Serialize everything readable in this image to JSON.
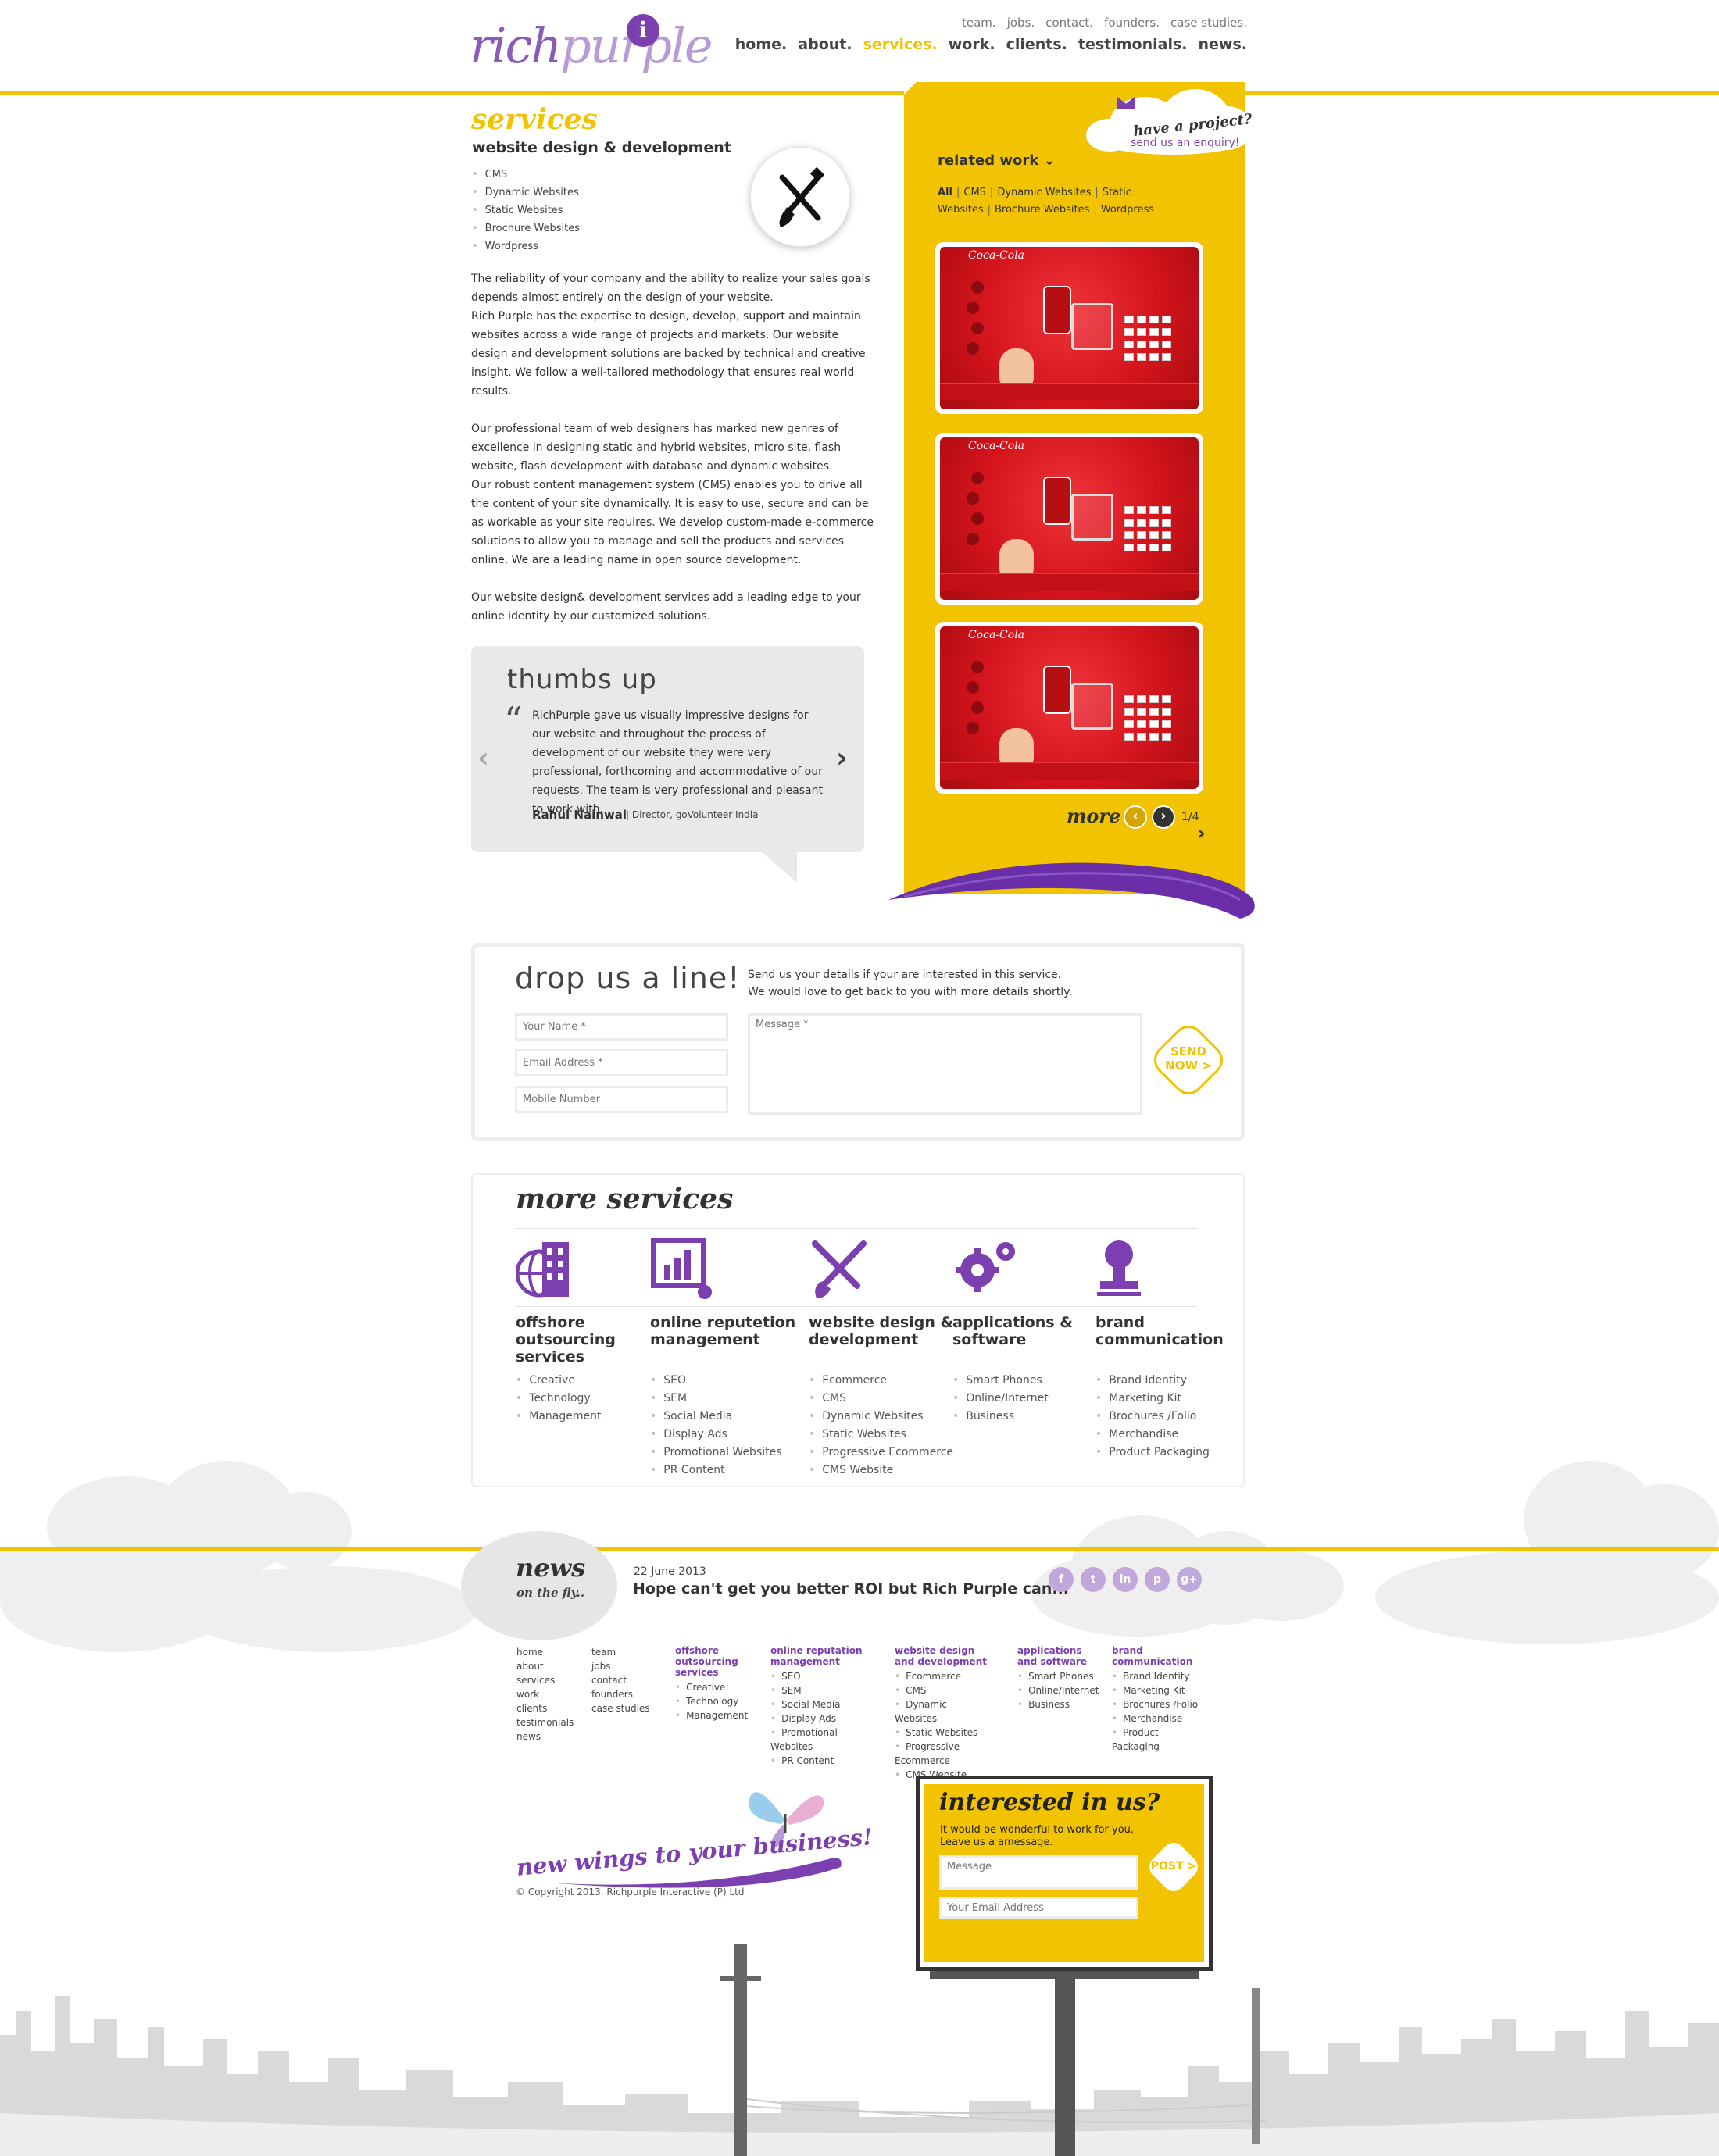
{
  "brand": {
    "part1": "rich",
    "part2": "purple",
    "badge": "i"
  },
  "top_links": [
    "team.",
    "jobs.",
    "contact.",
    "founders.",
    "case studies."
  ],
  "main_nav": [
    {
      "label": "home.",
      "active": false
    },
    {
      "label": "about.",
      "active": false
    },
    {
      "label": "services.",
      "active": true
    },
    {
      "label": "work.",
      "active": false
    },
    {
      "label": "clients.",
      "active": false
    },
    {
      "label": "testimonials.",
      "active": false
    },
    {
      "label": "news.",
      "active": false
    }
  ],
  "services": {
    "title": "services",
    "subtitle": "website design & development",
    "list": [
      "CMS",
      "Dynamic Websites",
      "Static Websites",
      "Brochure Websites",
      "Wordpress"
    ],
    "icon": "pencil-brush-icon",
    "paragraphs": [
      "The reliability of your company and the ability to realize your sales goals depends almost entirely on the design of your website.\nRich Purple has the expertise to design, develop, support and maintain websites across a wide range of projects and markets. Our website design and development solutions are backed by technical and creative insight. We follow a well-tailored methodology that ensures real world results.",
      "Our professional team of web designers has marked new genres of excellence in designing static and hybrid websites, micro site, flash website, flash development with database and dynamic websites.\nOur robust content management system (CMS) enables you to drive all the content of your site dynamically. It is easy to use, secure and can be as workable as your site requires. We develop custom-made e-commerce solutions to allow you to manage and sell the products and services online. We are a leading name in open source development.",
      "Our website design& development services add a leading edge to your online identity by our customized solutions."
    ]
  },
  "testimonial": {
    "title": "thumbs up",
    "quote_mark": "“",
    "text": "RichPurple gave us visually impressive designs for our website and throughout the process of development of our website they were very professional, forthcoming and accommodative of our requests. The team is very professional and pleasant to work with.",
    "author": "Rahul Nainwal",
    "role": "| Director, goVolunteer India",
    "prev": "‹",
    "next": "›"
  },
  "sidebar": {
    "project_question": "have a project?",
    "project_link": "send us an enquiry!",
    "related_heading": "related work ⌄",
    "filters": [
      "All",
      "CMS",
      "Dynamic Websites",
      "Static Websites",
      "Brochure Websites",
      "Wordpress"
    ],
    "thumb_logo": "Coca-Cola",
    "more_label": "more",
    "more_prev": "‹",
    "more_next": "›",
    "page_indicator": "1/4",
    "more_arrow": "›"
  },
  "contact": {
    "title": "drop us a line!",
    "desc_line1": "Send us your details if your are interested in this service.",
    "desc_line2": "We would love to get back to you with more details shortly.",
    "name_placeholder": "Your Name *",
    "email_placeholder": "Email Address *",
    "mobile_placeholder": "Mobile Number",
    "message_placeholder": "Message *",
    "send_line1": "SEND",
    "send_line2": "NOW >"
  },
  "more_services": {
    "title": "more services",
    "columns": [
      {
        "icon": "building-globe-icon",
        "title": "offshore outsourcing services",
        "items": [
          "Creative",
          "Technology",
          "Management"
        ]
      },
      {
        "icon": "chart-screen-icon",
        "title": "online reputetion management",
        "items": [
          "SEO",
          "SEM",
          "Social Media",
          "Display Ads",
          "Promotional Websites",
          "PR Content"
        ]
      },
      {
        "icon": "pencil-brush-icon",
        "title": "website design & development",
        "items": [
          "Ecommerce",
          "CMS",
          "Dynamic Websites",
          "Static Websites",
          "Progressive Ecommerce",
          "CMS Website"
        ]
      },
      {
        "icon": "gears-icon",
        "title": "applications & software",
        "items": [
          "Smart Phones",
          "Online/Internet",
          "Business"
        ]
      },
      {
        "icon": "stamp-icon",
        "title": "brand communication",
        "items": [
          "Brand Identity",
          "Marketing Kit",
          "Brochures /Folio",
          "Merchandise",
          "Product Packaging"
        ]
      }
    ]
  },
  "news": {
    "title": "news",
    "subtitle": "on the fly..",
    "date": "22 June 2013",
    "headline": "Hope can't get you better ROI but Rich Purple can..."
  },
  "social": [
    {
      "icon": "facebook-icon",
      "glyph": "f"
    },
    {
      "icon": "twitter-icon",
      "glyph": "t"
    },
    {
      "icon": "linkedin-icon",
      "glyph": "in"
    },
    {
      "icon": "pinterest-icon",
      "glyph": "p"
    },
    {
      "icon": "googleplus-icon",
      "glyph": "g+"
    }
  ],
  "footer": {
    "col1": [
      "home",
      "about",
      "services",
      "work",
      "clients",
      "testimonials",
      "news"
    ],
    "col2": [
      "team",
      "jobs",
      "contact",
      "founders",
      "case studies"
    ],
    "groups": [
      {
        "title": "offshore outsourcing services",
        "items": [
          "Creative",
          "Technology",
          "Management"
        ]
      },
      {
        "title": "online reputation management",
        "items": [
          "SEO",
          "SEM",
          "Social Media",
          "Display Ads",
          "Promotional Websites",
          "PR Content"
        ]
      },
      {
        "title": "website design and development",
        "items": [
          "Ecommerce",
          "CMS",
          "Dynamic Websites",
          "Static Websites",
          "Progressive Ecommerce",
          "CMS Website"
        ]
      },
      {
        "title": "applications and software",
        "items": [
          "Smart Phones",
          "Online/Internet",
          "Business"
        ]
      },
      {
        "title": "brand communication",
        "items": [
          "Brand Identity",
          "Marketing Kit",
          "Brochures /Folio",
          "Merchandise",
          "Product Packaging"
        ]
      }
    ],
    "tagline": "new wings to your business!",
    "copyright": "© Copyright 2013. Richpurple Interactive (P) Ltd"
  },
  "billboard": {
    "title": "interested in us?",
    "line1": "It would be wonderful to work for you.",
    "line2": "Leave us a amessage.",
    "message_placeholder": "Message",
    "email_placeholder": "Your Email Address",
    "post_label": "POST >"
  },
  "colors": {
    "yellow": "#f2c300",
    "purple": "#7b3fb0",
    "light_gray": "#e9e9e9"
  }
}
